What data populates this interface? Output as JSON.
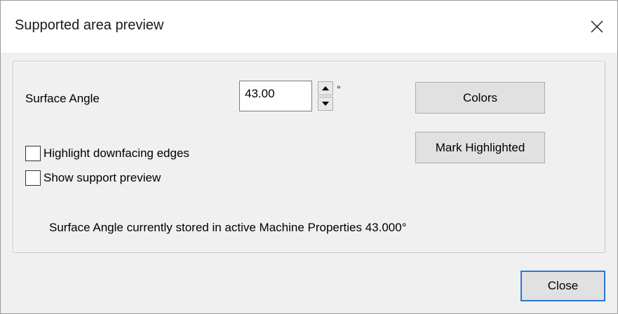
{
  "window": {
    "title": "Supported area preview",
    "close_icon": "close-icon"
  },
  "settings": {
    "surface_angle_label": "Surface Angle",
    "surface_angle_value": "43.00",
    "degree_symbol": "°",
    "colors_button": "Colors",
    "mark_highlighted_button": "Mark Highlighted",
    "highlight_downfacing_label": "Highlight downfacing edges",
    "highlight_downfacing_checked": false,
    "show_support_preview_label": "Show support preview",
    "show_support_preview_checked": false,
    "stored_angle_text": "Surface Angle currently stored in active Machine Properties 43.000°"
  },
  "footer": {
    "close_button": "Close"
  },
  "colors": {
    "accent_border": "#2b78d4",
    "button_face": "#e1e1e1",
    "window_bg": "#f0f0f0"
  }
}
